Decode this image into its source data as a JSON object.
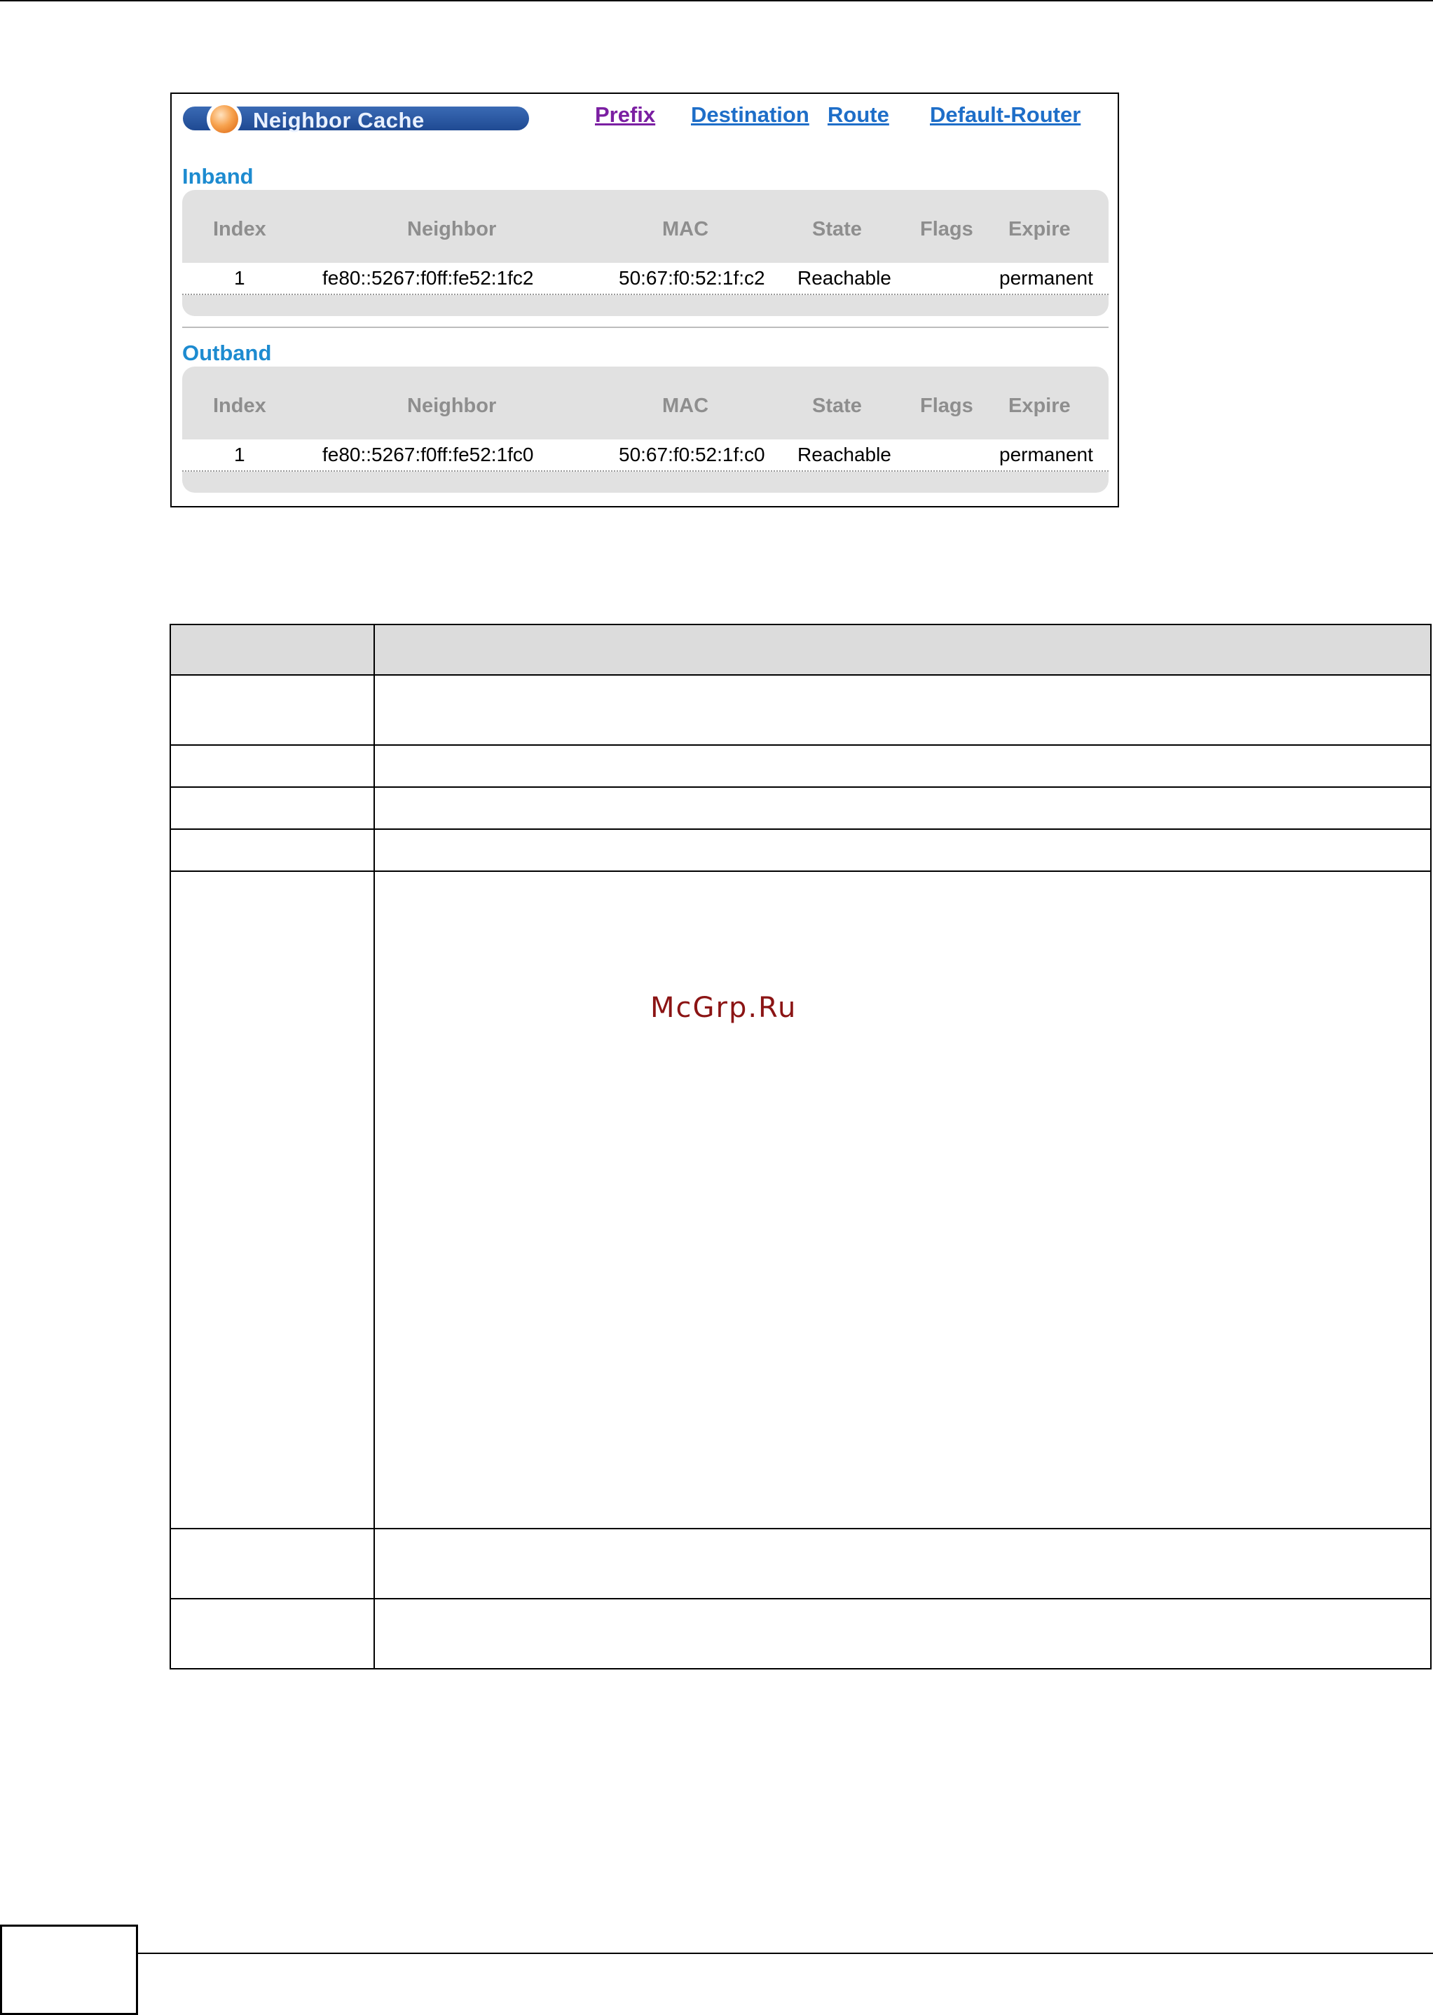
{
  "panel": {
    "title": "Neighbor Cache",
    "links": [
      {
        "label": "Prefix",
        "color": "#7b1fa2"
      },
      {
        "label": "Destination",
        "color": "#1e6ec8"
      },
      {
        "label": "Route",
        "color": "#1e6ec8"
      },
      {
        "label": "Default-Router",
        "color": "#1e6ec8"
      }
    ],
    "columns": [
      "Index",
      "Neighbor",
      "MAC",
      "State",
      "Flags",
      "Expire"
    ],
    "sections": [
      {
        "title": "Inband",
        "rows": [
          {
            "index": "1",
            "neighbor": "fe80::5267:f0ff:fe52:1fc2",
            "mac": "50:67:f0:52:1f:c2",
            "state": "Reachable",
            "flags": "",
            "expire": "permanent"
          }
        ]
      },
      {
        "title": "Outband",
        "rows": [
          {
            "index": "1",
            "neighbor": "fe80::5267:f0ff:fe52:1fc0",
            "mac": "50:67:f0:52:1f:c0",
            "state": "Reachable",
            "flags": "",
            "expire": "permanent"
          }
        ]
      }
    ]
  },
  "watermark": "McGrp.Ru"
}
